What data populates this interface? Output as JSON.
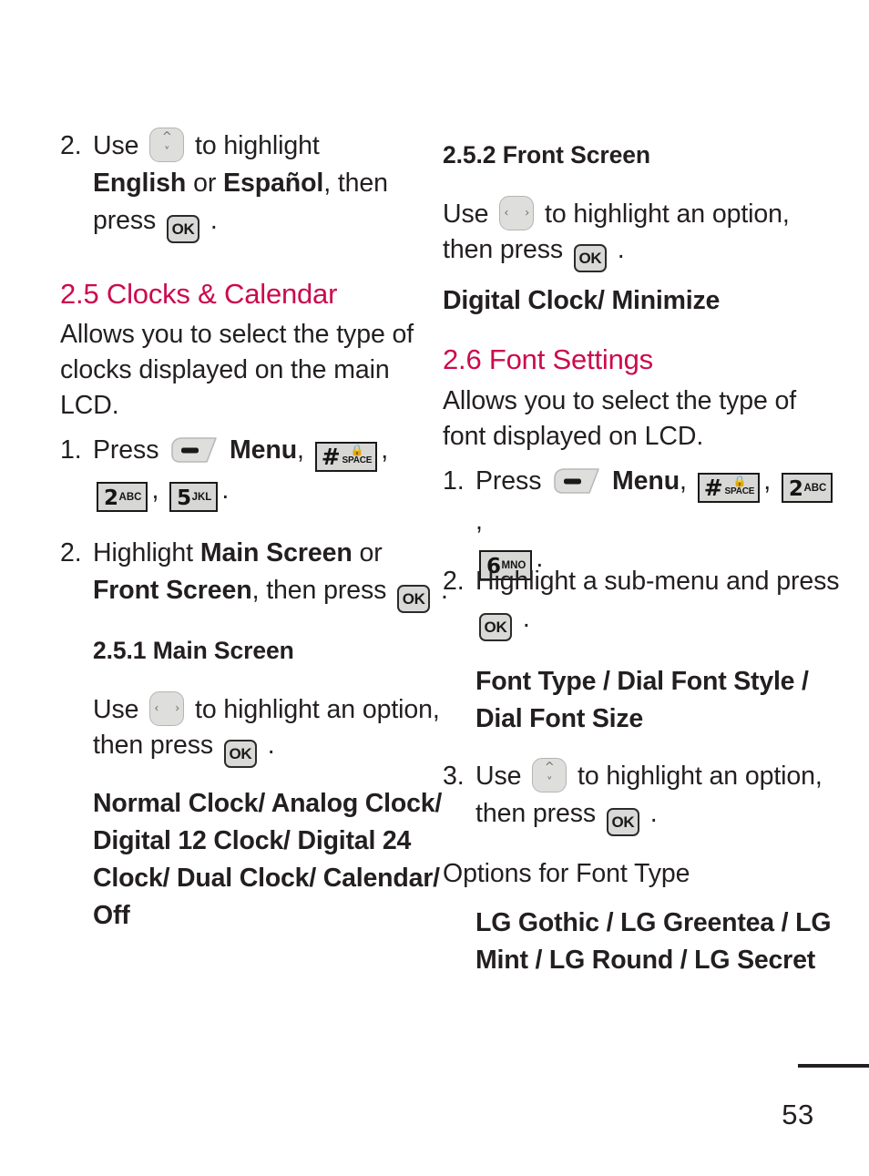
{
  "page": {
    "number": "53"
  },
  "icons": {
    "nav_up_down": "nav-up-down-key-icon",
    "nav_left_right": "nav-left-right-key-icon",
    "ok_key": "OK",
    "soft_menu_key": "soft-menu-key-icon",
    "key_hash": {
      "digit": "#",
      "lock": "\u0000",
      "sub": "SPACE"
    },
    "key_2": {
      "digit": "2",
      "sub": "ABC"
    },
    "key_5": {
      "digit": "5",
      "sub": "JKL"
    },
    "key_6": {
      "digit": "6",
      "sub": "MNO"
    }
  },
  "left_column": {
    "step2_lang": {
      "num": "2.",
      "part1": "Use",
      "part2": "to highlight",
      "bold1": "English",
      "mid": "or",
      "bold2": "Español",
      "part3": ", then",
      "part4": "press",
      "part5": "."
    },
    "heading_25": "2.5 Clocks & Calendar",
    "intro_25": "Allows you to select the type of clocks displayed on the main LCD.",
    "step1_25": {
      "num": "1.",
      "press": "Press",
      "menu": "Menu",
      "comma": ",",
      "end": "."
    },
    "step2_25": {
      "num": "2.",
      "text1": "Highlight",
      "bold1": "Main Screen",
      "or": "or",
      "bold2": "Front Screen",
      "text2": ", then press",
      "end": "."
    },
    "heading_251": "2.5.1 Main Screen",
    "use_251": {
      "part1": "Use",
      "part2": "to highlight an option, then press",
      "end": "."
    },
    "options_251": "Normal Clock/ Analog Clock/ Digital 12 Clock/ Digital 24 Clock/ Dual Clock/ Calendar/ Off"
  },
  "right_column": {
    "heading_252": "2.5.2 Front Screen",
    "use_252": {
      "part1": "Use",
      "part2": "to highlight an option, then press",
      "end": "."
    },
    "options_252": "Digital Clock/ Minimize",
    "heading_26": "2.6 Font Settings",
    "intro_26": "Allows you to select the type of font displayed on LCD.",
    "step1_26": {
      "num": "1.",
      "press": "Press",
      "menu": "Menu",
      "comma": ",",
      "end": "."
    },
    "step2_26": {
      "num": "2.",
      "text1": "Highlight a sub-menu and press",
      "end": "."
    },
    "submenus_26": "Font Type / Dial Font Style / Dial Font Size",
    "step3_26": {
      "num": "3.",
      "part1": "Use",
      "part2": "to highlight an option, then press",
      "end": "."
    },
    "options_label_26": "Options for Font Type",
    "options_26": "LG Gothic / LG Greentea / LG Mint / LG Round / LG Secret"
  },
  "colors": {
    "heading_accent": "#cc0a4e",
    "body_text": "#231f20",
    "key_fill": "#d7d7d6",
    "nav_fill": "#dededd"
  }
}
